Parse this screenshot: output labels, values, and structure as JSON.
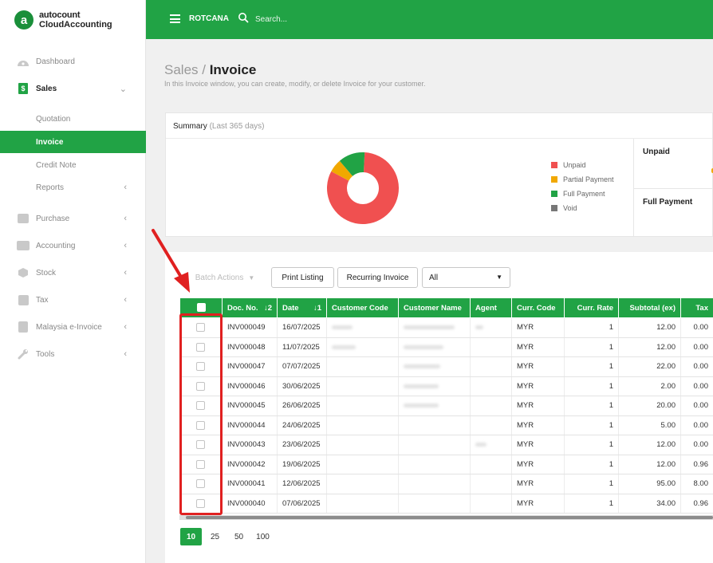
{
  "brand": {
    "top": "autocount",
    "bottom": "CloudAccounting",
    "logo_letter": "a"
  },
  "sidebar": {
    "items": [
      {
        "label": "Dashboard",
        "icon": "dashboard-icon"
      },
      {
        "label": "Sales",
        "icon": "sales-icon",
        "expanded": true
      },
      {
        "label": "Quotation"
      },
      {
        "label": "Invoice",
        "active": true
      },
      {
        "label": "Credit Note"
      },
      {
        "label": "Reports"
      },
      {
        "label": "Purchase",
        "icon": "purchase-icon"
      },
      {
        "label": "Accounting",
        "icon": "accounting-icon"
      },
      {
        "label": "Stock",
        "icon": "stock-icon"
      },
      {
        "label": "Tax",
        "icon": "tax-icon"
      },
      {
        "label": "Malaysia e-Invoice",
        "icon": "e-invoice-icon"
      },
      {
        "label": "Tools",
        "icon": "tools-icon"
      }
    ]
  },
  "topbar": {
    "company": "ROTCANA",
    "search_placeholder": "Search..."
  },
  "header": {
    "section": "Sales",
    "separator": " / ",
    "title": "Invoice",
    "description": "In this Invoice window, you can create, modify, or delete Invoice for your customer."
  },
  "summary": {
    "title": "Summary",
    "period": "(Last 365 days)",
    "legend": [
      {
        "label": "Unpaid",
        "color": "#f05050"
      },
      {
        "label": "Partial Payment",
        "color": "#f1a800"
      },
      {
        "label": "Full Payment",
        "color": "#21a345"
      },
      {
        "label": "Void",
        "color": "#777777"
      }
    ],
    "donut_values": [
      0.82,
      0.06,
      0.12,
      0.0
    ],
    "side": {
      "unpaid_label": "Unpaid",
      "full_payment_label": "Full Payment"
    }
  },
  "toolbar": {
    "batch_actions": "Batch Actions",
    "print_listing": "Print Listing",
    "recurring_invoice": "Recurring Invoice",
    "filter_value": "All"
  },
  "table": {
    "columns": [
      "Doc. No.",
      "Date",
      "Customer Code",
      "Customer Name",
      "Agent",
      "Curr. Code",
      "Curr. Rate",
      "Subtotal (ex)",
      "Tax"
    ],
    "sort_docno": "↓2",
    "sort_date": "↓1",
    "rows": [
      {
        "doc_no": "INV000049",
        "date": "16/07/2025",
        "curr_code": "MYR",
        "curr_rate": "1",
        "subtotal": "12.00",
        "tax": "0.00"
      },
      {
        "doc_no": "INV000048",
        "date": "11/07/2025",
        "curr_code": "MYR",
        "curr_rate": "1",
        "subtotal": "12.00",
        "tax": "0.00"
      },
      {
        "doc_no": "INV000047",
        "date": "07/07/2025",
        "curr_code": "MYR",
        "curr_rate": "1",
        "subtotal": "22.00",
        "tax": "0.00"
      },
      {
        "doc_no": "INV000046",
        "date": "30/06/2025",
        "curr_code": "MYR",
        "curr_rate": "1",
        "subtotal": "2.00",
        "tax": "0.00"
      },
      {
        "doc_no": "INV000045",
        "date": "26/06/2025",
        "curr_code": "MYR",
        "curr_rate": "1",
        "subtotal": "20.00",
        "tax": "0.00"
      },
      {
        "doc_no": "INV000044",
        "date": "24/06/2025",
        "curr_code": "MYR",
        "curr_rate": "1",
        "subtotal": "5.00",
        "tax": "0.00"
      },
      {
        "doc_no": "INV000043",
        "date": "23/06/2025",
        "curr_code": "MYR",
        "curr_rate": "1",
        "subtotal": "12.00",
        "tax": "0.00"
      },
      {
        "doc_no": "INV000042",
        "date": "19/06/2025",
        "curr_code": "MYR",
        "curr_rate": "1",
        "subtotal": "12.00",
        "tax": "0.96"
      },
      {
        "doc_no": "INV000041",
        "date": "12/06/2025",
        "curr_code": "MYR",
        "curr_rate": "1",
        "subtotal": "95.00",
        "tax": "8.00"
      },
      {
        "doc_no": "INV000040",
        "date": "07/06/2025",
        "curr_code": "MYR",
        "curr_rate": "1",
        "subtotal": "34.00",
        "tax": "0.96"
      }
    ]
  },
  "pager": {
    "sizes": [
      "10",
      "25",
      "50",
      "100"
    ],
    "active": "10"
  },
  "colors": {
    "brand_green": "#21a345",
    "annotation_red": "#e02020"
  }
}
